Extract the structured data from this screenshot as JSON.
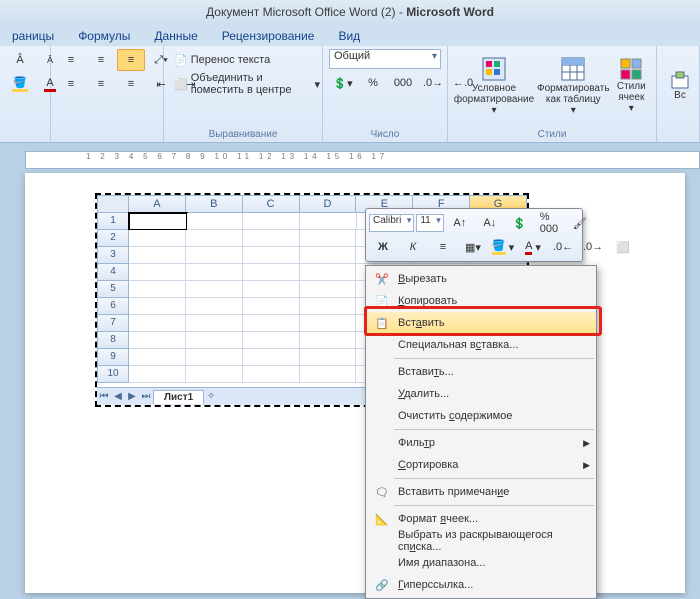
{
  "title_prefix": "Документ Microsoft Office Word (2) - ",
  "title_app": "Microsoft Word",
  "tabs": [
    "раницы",
    "Формулы",
    "Данные",
    "Рецензирование",
    "Вид"
  ],
  "ribbon": {
    "wrap_text": "Перенос текста",
    "merge_center": "Объединить и поместить в центре",
    "align_group": "Выравнивание",
    "number_format": "Общий",
    "number_group": "Число",
    "cond_format": "Условное форматирование",
    "format_table": "Форматировать как таблицу",
    "cell_styles": "Стили ячеек",
    "styles_group": "Стили",
    "insert_label": "Вс"
  },
  "sheet": {
    "cols": [
      "A",
      "B",
      "C",
      "D",
      "E",
      "F",
      "G"
    ],
    "rows": [
      1,
      2,
      3,
      4,
      5,
      6,
      7,
      8,
      9,
      10
    ],
    "tab": "Лист1"
  },
  "minitoolbar": {
    "font": "Calibri",
    "size": "11",
    "percent": "% 000"
  },
  "context_menu": [
    {
      "icon": "cut",
      "label": "Вырезать",
      "u": 0
    },
    {
      "icon": "copy",
      "label": "Копировать",
      "u": 0
    },
    {
      "icon": "paste",
      "label": "Вставить",
      "u": 3,
      "highlight": true
    },
    {
      "icon": "",
      "label": "Специальная вставка...",
      "u": 13
    },
    {
      "sep": true
    },
    {
      "icon": "",
      "label": "Вставить...",
      "u": 6
    },
    {
      "icon": "",
      "label": "Удалить...",
      "u": 0
    },
    {
      "icon": "",
      "label": "Очистить содержимое",
      "u": 9
    },
    {
      "sep": true
    },
    {
      "icon": "",
      "label": "Фильтр",
      "u": 4,
      "sub": true
    },
    {
      "icon": "",
      "label": "Сортировка",
      "u": 0,
      "sub": true
    },
    {
      "sep": true
    },
    {
      "icon": "comment",
      "label": "Вставить примечание",
      "u": 17
    },
    {
      "sep": true
    },
    {
      "icon": "format",
      "label": "Формат ячеек...",
      "u": 7
    },
    {
      "icon": "",
      "label": "Выбрать из раскрывающегося списка...",
      "u": 29
    },
    {
      "icon": "",
      "label": "Имя диапазона...",
      "u": 4
    },
    {
      "icon": "link",
      "label": "Гиперссылка...",
      "u": 0
    }
  ]
}
